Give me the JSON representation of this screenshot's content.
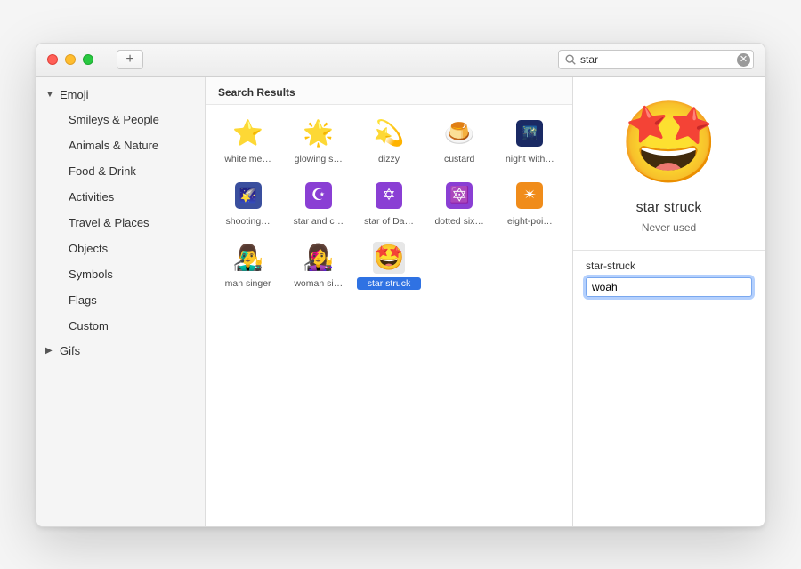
{
  "toolbar": {
    "add_button_label": "+",
    "search_value": "star",
    "search_placeholder": "Search"
  },
  "sidebar": {
    "groups": [
      {
        "label": "Emoji",
        "expanded": true,
        "items": [
          {
            "label": "Smileys & People"
          },
          {
            "label": "Animals & Nature"
          },
          {
            "label": "Food & Drink"
          },
          {
            "label": "Activities"
          },
          {
            "label": "Travel & Places"
          },
          {
            "label": "Objects"
          },
          {
            "label": "Symbols"
          },
          {
            "label": "Flags"
          },
          {
            "label": "Custom"
          }
        ]
      },
      {
        "label": "Gifs",
        "expanded": false,
        "items": []
      }
    ]
  },
  "results": {
    "header": "Search Results",
    "items": [
      {
        "glyph": "⭐",
        "label": "white me…",
        "style": "plain"
      },
      {
        "glyph": "🌟",
        "label": "glowing s…",
        "style": "plain"
      },
      {
        "glyph": "💫",
        "label": "dizzy",
        "style": "plain"
      },
      {
        "glyph": "🍮",
        "label": "custard",
        "style": "plain"
      },
      {
        "glyph": "🌃",
        "label": "night with…",
        "style": "night"
      },
      {
        "glyph": "🌠",
        "label": "shooting…",
        "style": "sky"
      },
      {
        "glyph": "☪",
        "label": "star and c…",
        "style": "purple"
      },
      {
        "glyph": "✡",
        "label": "star of Da…",
        "style": "purple"
      },
      {
        "glyph": "🔯",
        "label": "dotted six…",
        "style": "purple"
      },
      {
        "glyph": "✴",
        "label": "eight-poi…",
        "style": "orange"
      },
      {
        "glyph": "👨‍🎤",
        "label": "man singer",
        "style": "plain"
      },
      {
        "glyph": "👩‍🎤",
        "label": "woman si…",
        "style": "plain"
      },
      {
        "glyph": "🤩",
        "label": "star struck",
        "style": "plain",
        "selected": true
      }
    ]
  },
  "detail": {
    "preview_glyph": "🤩",
    "title": "star struck",
    "usage": "Never used",
    "keyword_label": "star-struck",
    "keyword_value": "woah"
  }
}
